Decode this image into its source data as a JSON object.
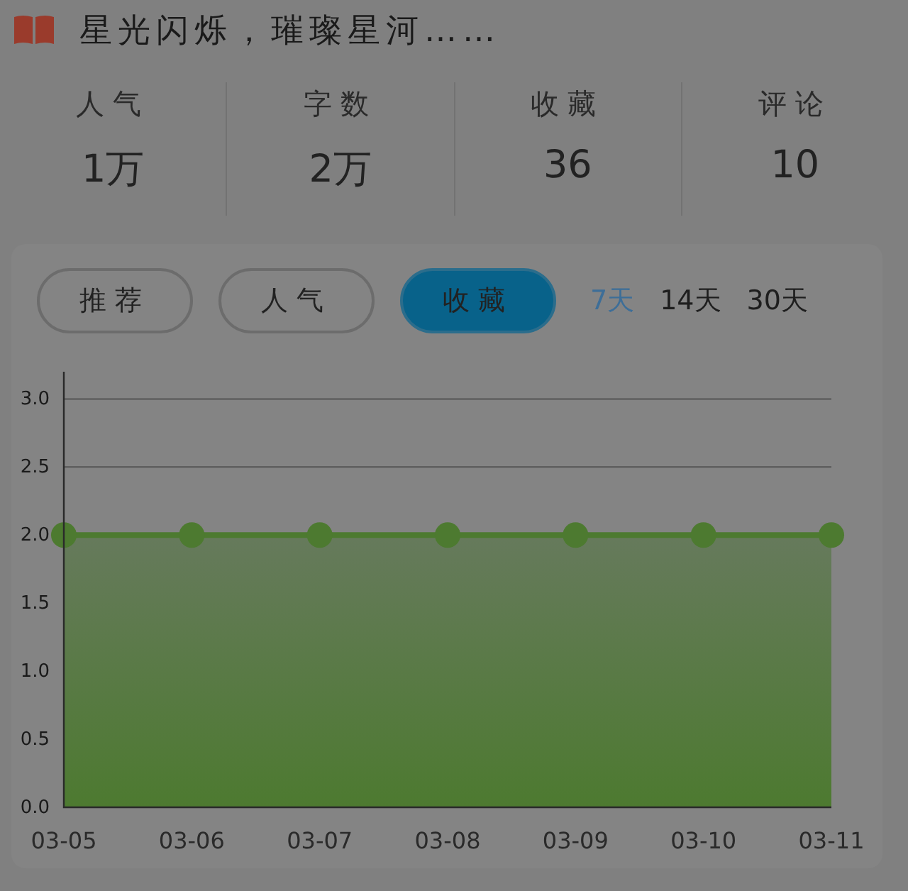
{
  "header": {
    "title": "星光闪烁，璀璨星河……"
  },
  "stats": [
    {
      "label": "人气",
      "value": "1万"
    },
    {
      "label": "字数",
      "value": "2万"
    },
    {
      "label": "收藏",
      "value": "36"
    },
    {
      "label": "评论",
      "value": "10"
    }
  ],
  "metric_tabs": [
    {
      "label": "推荐",
      "selected": false
    },
    {
      "label": "人气",
      "selected": false
    },
    {
      "label": "收藏",
      "selected": true
    }
  ],
  "range_tabs": [
    {
      "label": "7天",
      "selected": true
    },
    {
      "label": "14天",
      "selected": false
    },
    {
      "label": "30天",
      "selected": false
    }
  ],
  "chart_data": {
    "type": "area",
    "grid": true,
    "categories": [
      "03-05",
      "03-06",
      "03-07",
      "03-08",
      "03-09",
      "03-10",
      "03-11"
    ],
    "ylim": [
      0,
      3.2
    ],
    "yticks": [
      {
        "value": 0,
        "label": "0.0"
      },
      {
        "value": 0.5,
        "label": "0.5"
      },
      {
        "value": 1,
        "label": "1.0"
      },
      {
        "value": 1.5,
        "label": "1.5"
      },
      {
        "value": 2,
        "label": "2.0"
      },
      {
        "value": 2.5,
        "label": "2.5"
      },
      {
        "value": 3,
        "label": "3.0"
      }
    ],
    "series": [
      {
        "color": "#4d7a30",
        "values": [
          2,
          2,
          2,
          2,
          2,
          2,
          2
        ]
      }
    ]
  }
}
